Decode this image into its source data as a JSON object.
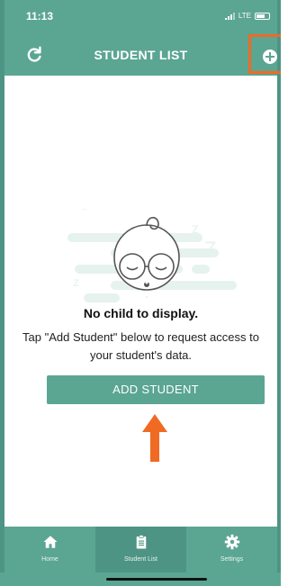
{
  "status_bar": {
    "time": "11:13",
    "network": "LTE"
  },
  "header": {
    "title": "STUDENT LIST",
    "left_icon": "refresh-icon",
    "right_icon": "add-circle-icon"
  },
  "empty_state": {
    "illustration": "sleeping-baby-icon",
    "title": "No child to display.",
    "description": "Tap \"Add Student\" below to request access to your student's data.",
    "button_label": "ADD STUDENT"
  },
  "tab_bar": {
    "items": [
      {
        "label": "Home",
        "icon": "home-icon",
        "active": false
      },
      {
        "label": "Student List",
        "icon": "clipboard-icon",
        "active": true
      },
      {
        "label": "Settings",
        "icon": "gear-icon",
        "active": false
      }
    ]
  },
  "colors": {
    "primary": "#5ba593",
    "primary_dark": "#4e9485",
    "highlight": "#f06a24"
  }
}
